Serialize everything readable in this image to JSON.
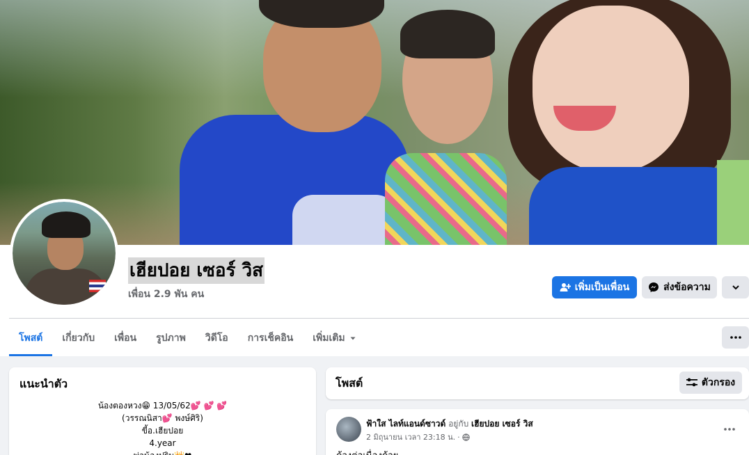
{
  "profile": {
    "name": "เฮียปอย เซอร์ วิส",
    "friends_count": "เพื่อน 2.9 พัน คน"
  },
  "actions": {
    "add_friend": "เพิ่มเป็นเพื่อน",
    "message": "ส่งข้อความ"
  },
  "tabs": [
    {
      "label": "โพสต์",
      "active": true
    },
    {
      "label": "เกี่ยวกับ"
    },
    {
      "label": "เพื่อน"
    },
    {
      "label": "รูปภาพ"
    },
    {
      "label": "วิดีโอ"
    },
    {
      "label": "การเช็คอิน"
    },
    {
      "label": "เพิ่มเติม"
    }
  ],
  "intro": {
    "title": "แนะนำตัว",
    "bio_lines": [
      "น้องตองหวง😁 13/05/62💕 💕 💕",
      "(วรรณนิสา💕 พงษ์ศิริ)",
      "ขี้อ.เฮียปอย",
      "4.year",
      "พ่อน้องปริม👑❤"
    ]
  },
  "posts_section": {
    "title": "โพสต์",
    "filter_label": "ตัวกรอง"
  },
  "post": {
    "author": "ฟ้าใส ไลท์แอนด์ซาวด์",
    "connector": "อยู่กับ",
    "tagged": "เฮียปอย เซอร์ วิส",
    "timestamp": "2 มิถุนายน เวลา 23:18 น.",
    "separator": "·",
    "body": "ด้วงต่อเนื่องด้วย"
  },
  "colors": {
    "accent": "#1b74e4",
    "secondary_button": "#e4e6eb",
    "page_bg": "#f0f2f5"
  },
  "icons": {
    "add_friend": "person-plus-icon",
    "message": "messenger-icon",
    "more": "chevron-down-icon",
    "tab_more": "caret-down-icon",
    "overflow": "ellipsis-icon",
    "filter": "sliders-icon",
    "privacy": "globe-icon"
  }
}
